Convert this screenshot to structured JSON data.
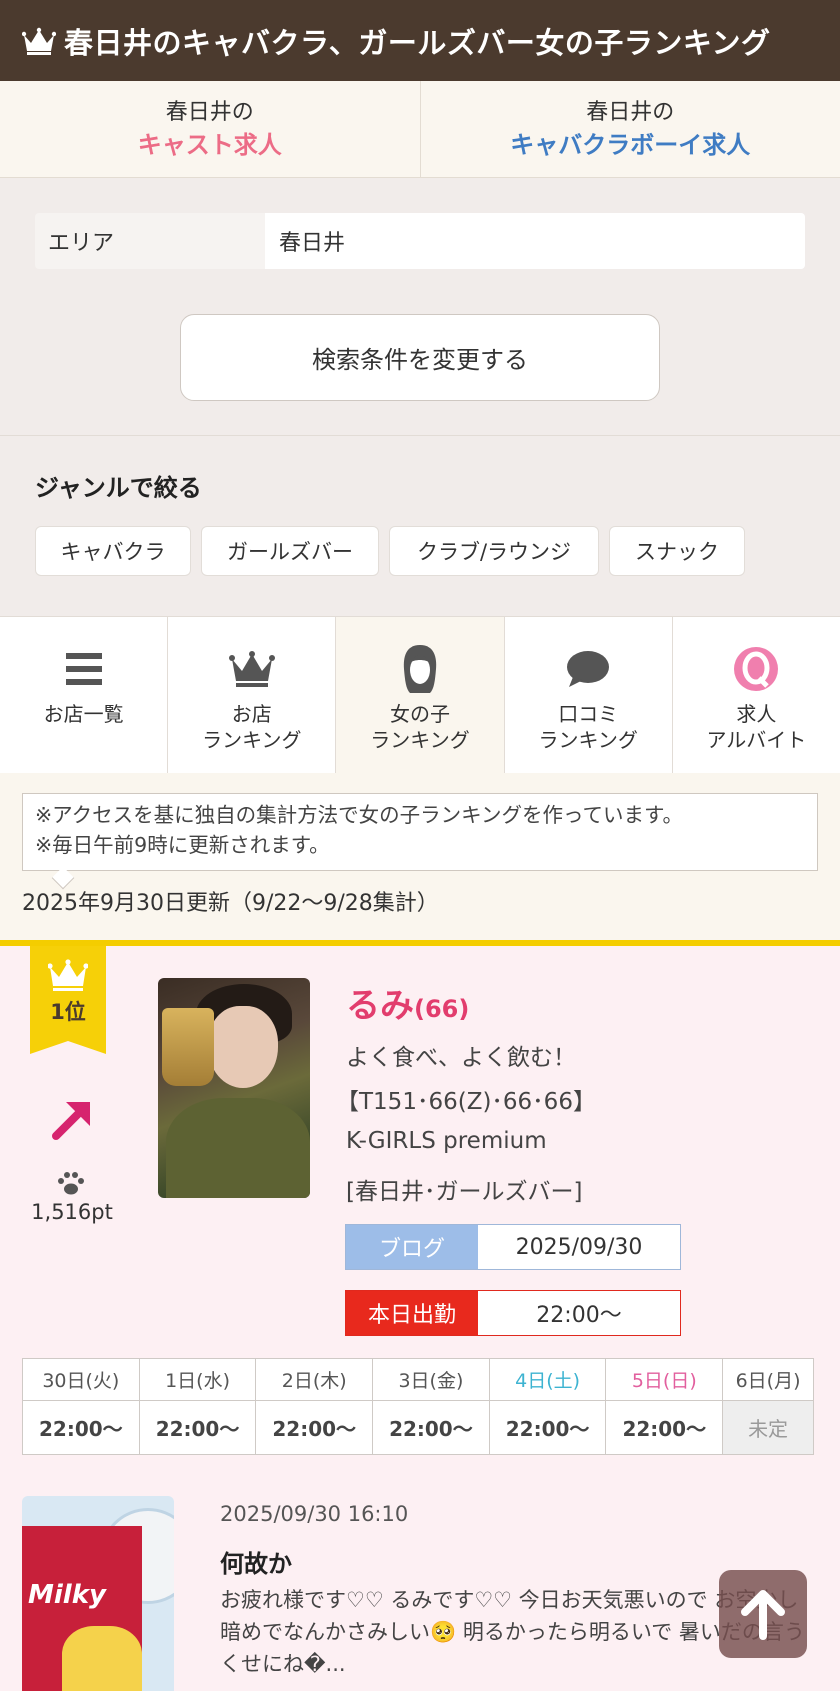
{
  "header": {
    "title": "春日井のキャバクラ、ガールズバー女の子ランキング"
  },
  "job_links": [
    {
      "city": "春日井の",
      "label": "キャスト求人"
    },
    {
      "city": "春日井の",
      "label": "キャバクラボーイ求人"
    }
  ],
  "search": {
    "area_label": "エリア",
    "area_value": "春日井",
    "change_button": "検索条件を変更する"
  },
  "genre": {
    "heading": "ジャンルで絞る",
    "chips": [
      "キャバクラ",
      "ガールズバー",
      "クラブ/ラウンジ",
      "スナック"
    ]
  },
  "nav": [
    {
      "line1": "お店一覧",
      "line2": "",
      "icon": "list-icon"
    },
    {
      "line1": "お店",
      "line2": "ランキング",
      "icon": "crown-icon"
    },
    {
      "line1": "女の子",
      "line2": "ランキング",
      "icon": "girl-icon"
    },
    {
      "line1": "口コミ",
      "line2": "ランキング",
      "icon": "speech-bubble-icon"
    },
    {
      "line1": "求人",
      "line2": "アルバイト",
      "icon": "q-job-icon"
    }
  ],
  "notice": {
    "line1": "※アクセスを基に独自の集計方法で女の子ランキングを作っています。",
    "line2": "※毎日午前9時に更新されます。"
  },
  "updated": "2025年9月30日更新（9/22〜9/28集計）",
  "ranking": {
    "rank": "1位",
    "trend": "up",
    "points": "1,516pt",
    "name": "るみ",
    "age": "(66)",
    "catch": "よく食べ、よく飲む！",
    "spec": "【T151･66(Z)･66･66】",
    "shop": "K-GIRLS premium",
    "shop_category": "[春日井･ガールズバー]",
    "blog_label": "ブログ",
    "blog_date": "2025/09/30",
    "shift_label": "本日出勤",
    "shift_time": "22:00〜",
    "schedule": {
      "days": [
        "30日(火)",
        "1日(水)",
        "2日(木)",
        "3日(金)",
        "4日(土)",
        "5日(日)",
        "6日(月)"
      ],
      "times": [
        "22:00〜",
        "22:00〜",
        "22:00〜",
        "22:00〜",
        "22:00〜",
        "22:00〜",
        "未定"
      ]
    },
    "blog_post": {
      "date": "2025/09/30 16:10",
      "title": "何故か",
      "excerpt": " お疲れ様です♡♡ るみです♡♡ 今日お天気悪いので お空少し暗めでなんかさみしい🥺 明るかったら明るいで 暑いだの言うくせにね�...",
      "thumb_label": "Milky"
    }
  },
  "colors": {
    "header_bg": "#4b3a2e",
    "cast_pink": "#ec6c86",
    "boy_blue": "#3f7cc3",
    "rank_gold": "#f4cd00",
    "name_pink": "#e23d6d",
    "shift_red": "#e8291d",
    "blog_blue": "#9dbde8",
    "saturday": "#3db3d1",
    "sunday": "#e25f9e"
  }
}
